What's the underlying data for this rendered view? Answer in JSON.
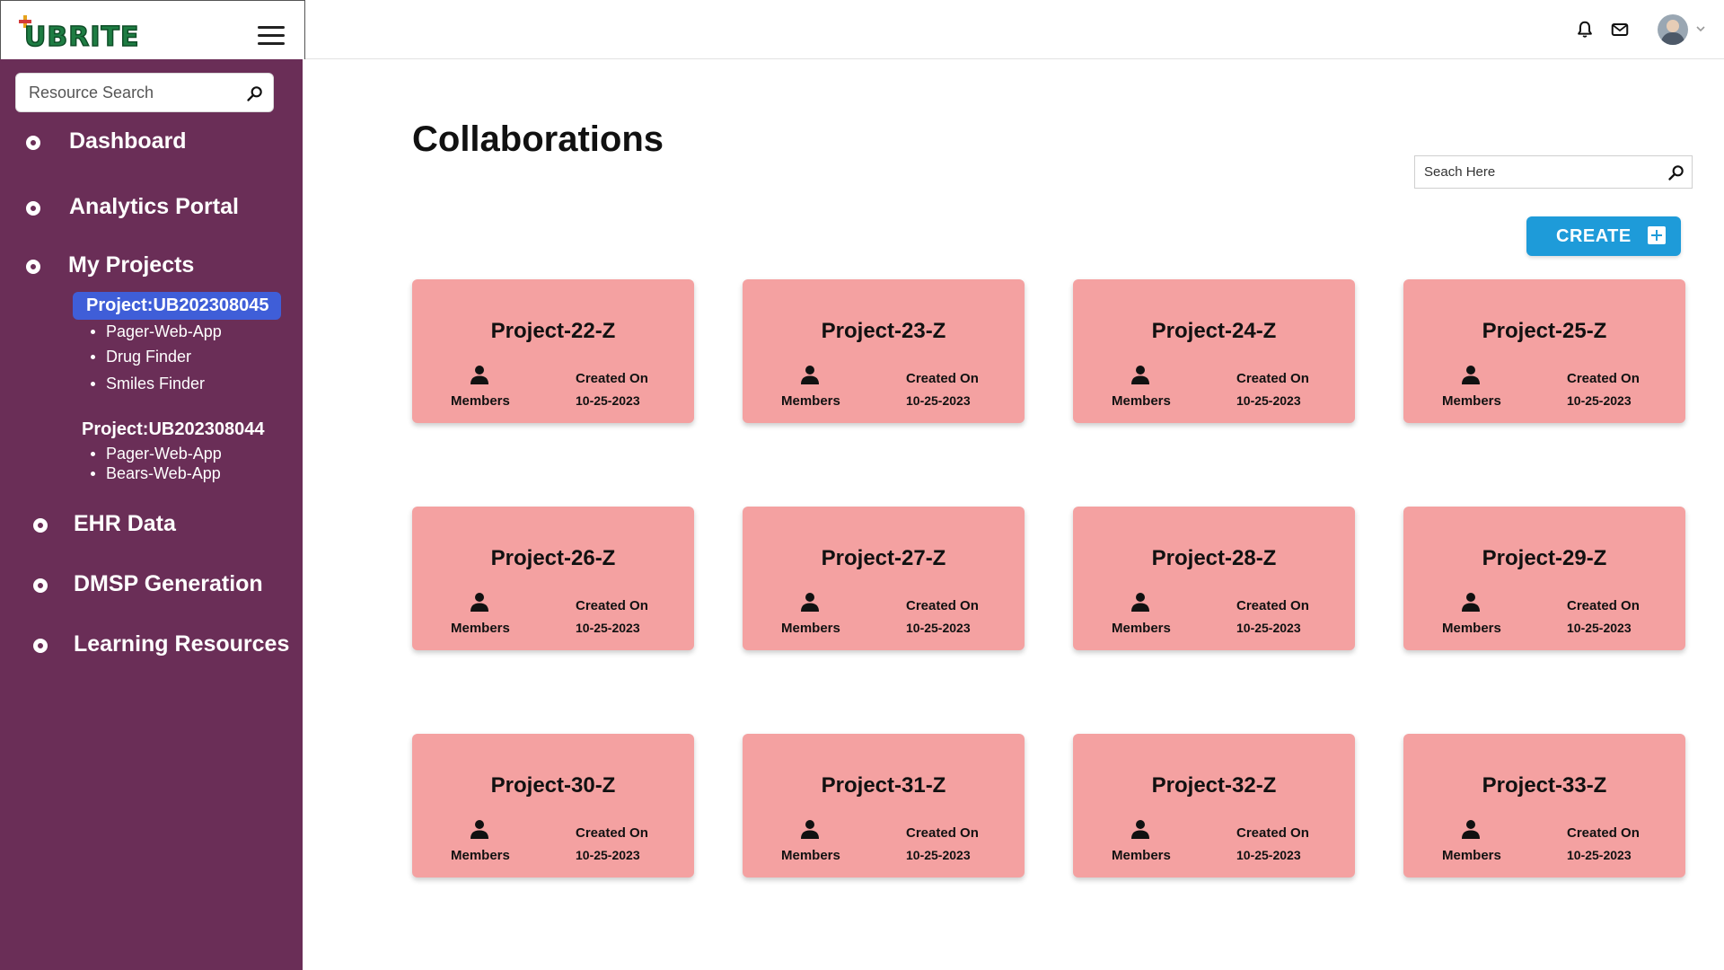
{
  "app": {
    "logo_text": "UBRITE"
  },
  "sidebar": {
    "search_placeholder": "Resource Search",
    "nav": {
      "dashboard": "Dashboard",
      "analytics": "Analytics Portal",
      "my_projects": "My Projects",
      "ehr": "EHR Data",
      "dmsp": "DMSP Generation",
      "learning": "Learning Resources"
    },
    "projects": [
      {
        "name": "Project:UB202308045",
        "apps": [
          "Pager-Web-App",
          "Drug Finder",
          "Smiles Finder"
        ]
      },
      {
        "name": "Project:UB202308044",
        "apps": [
          "Pager-Web-App",
          "Bears-Web-App"
        ]
      }
    ]
  },
  "main": {
    "title": "Collaborations",
    "search_placeholder": "Seach Here",
    "create_label": "CREATE",
    "card_labels": {
      "members": "Members",
      "created_on": "Created On"
    },
    "cards": [
      {
        "name": "Project-22-Z",
        "date": "10-25-2023"
      },
      {
        "name": "Project-23-Z",
        "date": "10-25-2023"
      },
      {
        "name": "Project-24-Z",
        "date": "10-25-2023"
      },
      {
        "name": "Project-25-Z",
        "date": "10-25-2023"
      },
      {
        "name": "Project-26-Z",
        "date": "10-25-2023"
      },
      {
        "name": "Project-27-Z",
        "date": "10-25-2023"
      },
      {
        "name": "Project-28-Z",
        "date": "10-25-2023"
      },
      {
        "name": "Project-29-Z",
        "date": "10-25-2023"
      },
      {
        "name": "Project-30-Z",
        "date": "10-25-2023"
      },
      {
        "name": "Project-31-Z",
        "date": "10-25-2023"
      },
      {
        "name": "Project-32-Z",
        "date": "10-25-2023"
      },
      {
        "name": "Project-33-Z",
        "date": "10-25-2023"
      }
    ]
  },
  "colors": {
    "sidebar": "#6a2e57",
    "active_project": "#3f5ed8",
    "card": "#f4a1a1",
    "create_button": "#1e9bd9",
    "logo": "#1e7d43"
  },
  "icons": {
    "menu": "hamburger-icon",
    "search": "search-icon",
    "notifications": "bell-icon",
    "messages": "mail-icon",
    "members": "user-icon",
    "create": "plus-icon"
  }
}
